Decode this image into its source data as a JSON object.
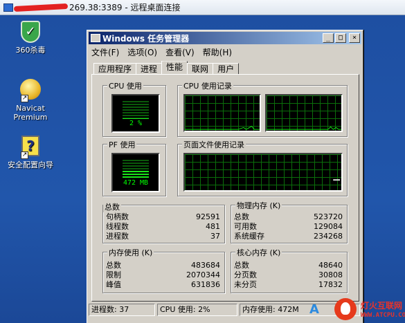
{
  "rdp": {
    "title_visible": "269.38:3389 - 远程桌面连接"
  },
  "desktop": {
    "icons": [
      {
        "label": "360杀毒",
        "icon": "shield-icon"
      },
      {
        "label": "Navicat\nPremium",
        "icon": "navicat-icon"
      },
      {
        "label": "安全配置向导",
        "icon": "wizard-icon"
      }
    ]
  },
  "taskmgr": {
    "title": "Windows 任务管理器",
    "controls": {
      "minimize": "_",
      "maximize": "□",
      "close": "×"
    },
    "menu": [
      "文件(F)",
      "选项(O)",
      "查看(V)",
      "帮助(H)"
    ],
    "tabs": [
      "应用程序",
      "进程",
      "性能",
      "联网",
      "用户"
    ],
    "active_tab": "性能",
    "performance": {
      "cpu_usage_label": "CPU 使用",
      "cpu_usage_value": "2 %",
      "cpu_usage_percent": 2,
      "cpu_history_label": "CPU 使用记录",
      "pf_usage_label": "PF 使用",
      "pf_usage_value": "472 MB",
      "pf_history_label": "页面文件使用记录",
      "totals": {
        "label": "总数",
        "rows": [
          {
            "k": "句柄数",
            "v": "92591"
          },
          {
            "k": "线程数",
            "v": "481"
          },
          {
            "k": "进程数",
            "v": "37"
          }
        ]
      },
      "physical_memory": {
        "label": "物理内存 (K)",
        "rows": [
          {
            "k": "总数",
            "v": "523720"
          },
          {
            "k": "可用数",
            "v": "129084"
          },
          {
            "k": "系统缓存",
            "v": "234268"
          }
        ]
      },
      "commit_charge": {
        "label": "内存使用 (K)",
        "rows": [
          {
            "k": "总数",
            "v": "483684"
          },
          {
            "k": "限制",
            "v": "2070344"
          },
          {
            "k": "峰值",
            "v": "631836"
          }
        ]
      },
      "kernel_memory": {
        "label": "核心内存 (K)",
        "rows": [
          {
            "k": "总数",
            "v": "48640"
          },
          {
            "k": "分页数",
            "v": "30808"
          },
          {
            "k": "未分页",
            "v": "17832"
          }
        ]
      }
    },
    "status": {
      "processes": "进程数: 37",
      "cpu": "CPU 使用: 2%",
      "commit": "内存使用: 472M"
    }
  },
  "watermark": {
    "cn": "灯火互联网",
    "url": "WWW.ATCPU.COM"
  }
}
